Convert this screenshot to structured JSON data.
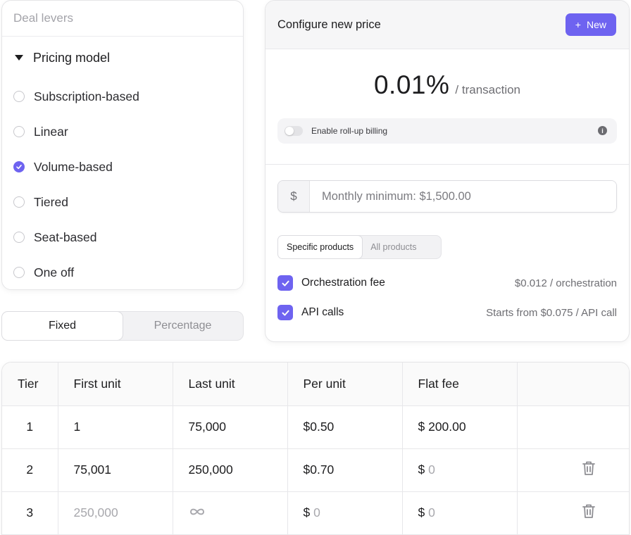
{
  "deal_levers": {
    "title": "Deal levers",
    "group_label": "Pricing model",
    "options": [
      {
        "label": "Subscription-based",
        "selected": false
      },
      {
        "label": "Linear",
        "selected": false
      },
      {
        "label": "Volume-based",
        "selected": true
      },
      {
        "label": "Tiered",
        "selected": false
      },
      {
        "label": "Seat-based",
        "selected": false
      },
      {
        "label": "One off",
        "selected": false
      }
    ]
  },
  "fee_type": {
    "options": [
      "Fixed",
      "Percentage"
    ],
    "selected": "Fixed"
  },
  "configure": {
    "title": "Configure new price",
    "new_button": "New",
    "price_value": "0.01%",
    "price_unit": "/ transaction",
    "rollup_label": "Enable roll-up billing",
    "rollup_enabled": false,
    "minimum": {
      "currency_symbol": "$",
      "placeholder": "Monthly minimum: $1,500.00"
    },
    "scope_tabs": [
      "Specific products",
      "All products"
    ],
    "scope_selected": "Specific products",
    "products": [
      {
        "name": "Orchestration fee",
        "rate": "$0.012 / orchestration",
        "checked": true
      },
      {
        "name": "API calls",
        "rate": "Starts from $0.075 / API call",
        "checked": true
      }
    ]
  },
  "tiers": {
    "columns": [
      "Tier",
      "First unit",
      "Last unit",
      "Per unit",
      "Flat fee"
    ],
    "rows": [
      {
        "tier": "1",
        "first": "1",
        "last": "75,000",
        "per_unit": "$0.50",
        "flat_fee": "$ 200.00",
        "deletable": false
      },
      {
        "tier": "2",
        "first": "75,001",
        "last": "250,000",
        "per_unit": "$0.70",
        "flat_fee_symbol": "$",
        "flat_fee_placeholder": "0",
        "deletable": true
      },
      {
        "tier": "3",
        "first_placeholder": "250,000",
        "last_symbol": "∞",
        "per_unit_symbol": "$",
        "per_unit_placeholder": "0",
        "flat_fee_symbol": "$",
        "flat_fee_placeholder": "0",
        "deletable": true
      }
    ]
  },
  "colors": {
    "accent": "#6e63f0",
    "muted_text": "#a8a8ad",
    "border": "#e7e7ea"
  }
}
